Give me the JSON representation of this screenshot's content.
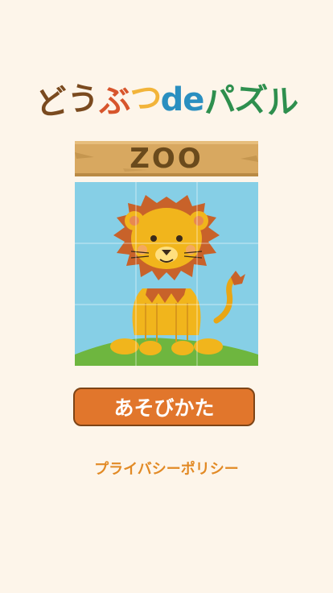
{
  "app_title": {
    "chars": [
      {
        "ch": "ど",
        "color": "#7a4a1f"
      },
      {
        "ch": "う",
        "color": "#7a4a1f"
      },
      {
        "ch": "ぶ",
        "color": "#d7552c"
      },
      {
        "ch": "つ",
        "color": "#f2b43a"
      },
      {
        "ch": "de",
        "color": "#2a8fc0"
      },
      {
        "ch": "パ",
        "color": "#2e8f4e"
      },
      {
        "ch": "ズ",
        "color": "#2e8f4e"
      },
      {
        "ch": "ル",
        "color": "#2e8f4e"
      }
    ]
  },
  "sign": {
    "label": "ZOO"
  },
  "puzzle": {
    "rows": 3,
    "cols": 3,
    "animal": "lion"
  },
  "play_button": {
    "label": "あそびかた"
  },
  "privacy_link": {
    "label": "プライバシーポリシー"
  },
  "colors": {
    "background": "#fdf5ea",
    "button": "#e1762c",
    "button_border": "#7d4416",
    "link": "#e28a25",
    "sky": "#86cfe6",
    "grass": "#6eb63f",
    "lion_body": "#f1b51c",
    "mane": "#c8622a",
    "sign_wood": "#d8a860"
  }
}
